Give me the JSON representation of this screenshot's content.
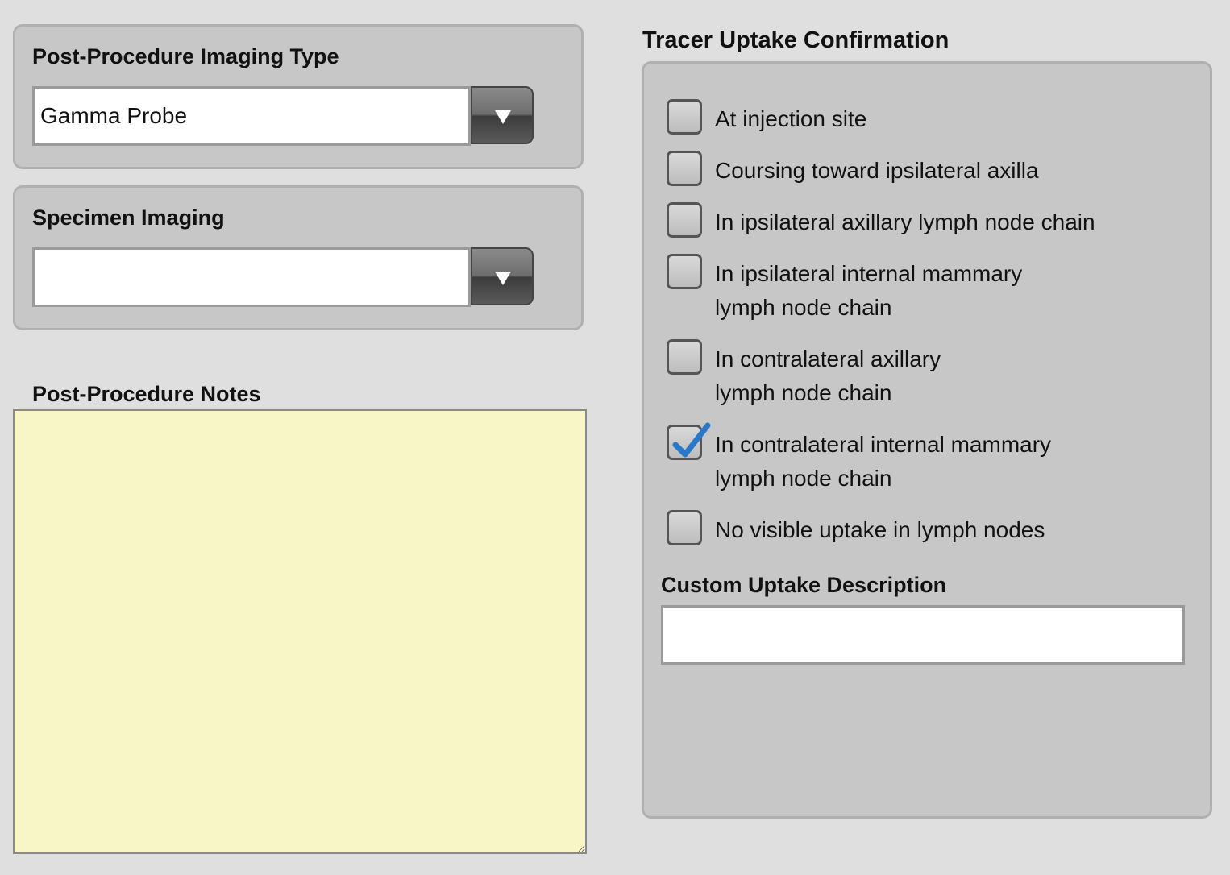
{
  "imaging_type": {
    "label": "Post-Procedure Imaging Type",
    "value": "Gamma Probe"
  },
  "specimen_imaging": {
    "label": "Specimen Imaging",
    "value": ""
  },
  "notes": {
    "label": "Post-Procedure Notes",
    "value": "",
    "background_color": "#f8f6c6"
  },
  "tracer": {
    "title": "Tracer Uptake Confirmation",
    "options": [
      {
        "line1": "At injection site",
        "line2": "",
        "checked": false
      },
      {
        "line1": "Coursing toward ipsilateral axilla",
        "line2": "",
        "checked": false
      },
      {
        "line1": "In ipsilateral axillary lymph node chain",
        "line2": "",
        "checked": false
      },
      {
        "line1": "In ipsilateral internal mammary",
        "line2": "lymph node chain",
        "checked": false
      },
      {
        "line1": "In contralateral axillary",
        "line2": "lymph node chain",
        "checked": false
      },
      {
        "line1": "In contralateral internal mammary",
        "line2": "lymph node chain",
        "checked": true
      },
      {
        "line1": "No visible uptake in lymph nodes",
        "line2": "",
        "checked": false
      }
    ],
    "custom_label": "Custom Uptake Description",
    "custom_value": "",
    "check_color": "#2a78c8"
  }
}
